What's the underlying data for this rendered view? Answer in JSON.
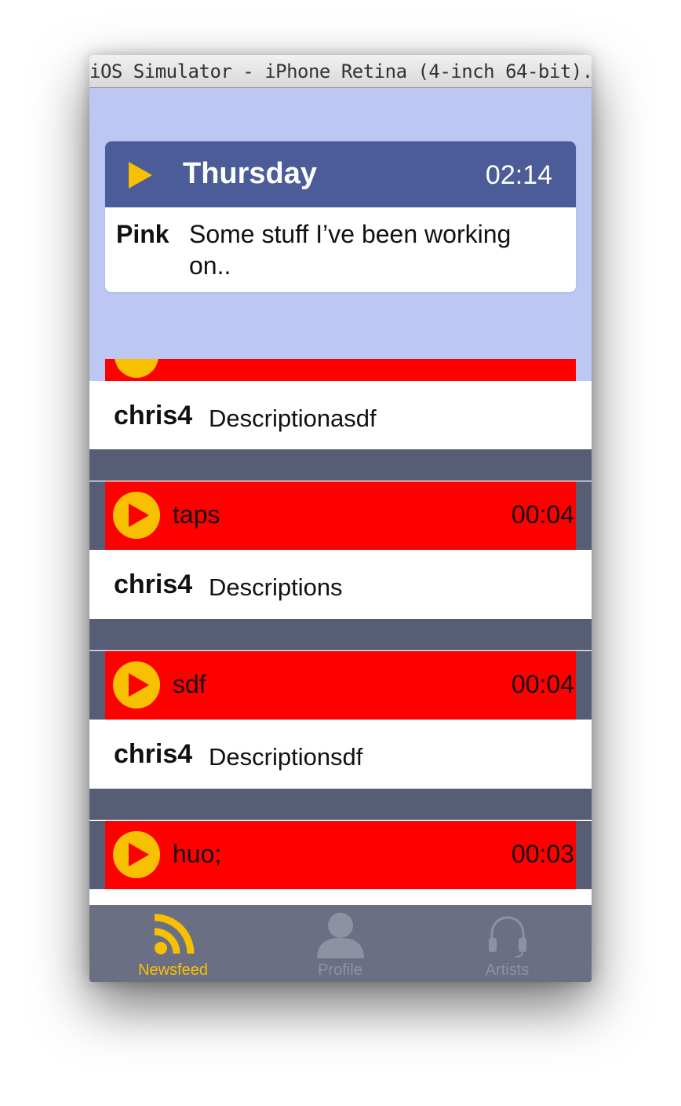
{
  "window": {
    "title": "iOS Simulator - iPhone Retina (4-inch 64-bit)..."
  },
  "now_playing": {
    "title": "Thursday",
    "time": "02:14",
    "user": "Pink",
    "description": "Some stuff I’ve been working on.."
  },
  "posts": [
    {
      "user": "chris4",
      "description": "Descriptionasdf"
    },
    {
      "track": "taps",
      "time": "00:04",
      "user": "chris4",
      "description": "Descriptions"
    },
    {
      "track": "sdf",
      "time": "00:04",
      "user": "chris4",
      "description": "Descriptionsdf"
    },
    {
      "track": "huo;",
      "time": "00:03"
    }
  ],
  "tabbar": {
    "items": [
      {
        "label": "Newsfeed",
        "icon": "rss-icon",
        "active": true
      },
      {
        "label": "Profile",
        "icon": "person-icon",
        "active": false
      },
      {
        "label": "Artists",
        "icon": "headphones-icon",
        "active": false
      }
    ]
  },
  "colors": {
    "header_bg": "#bcc7f4",
    "card_header": "#4b5c99",
    "accent": "#f7c101",
    "track_bg": "#ff0000",
    "separator": "#575d74",
    "tabbar_bg": "#6b6f84",
    "tab_inactive": "#8d91a3"
  }
}
